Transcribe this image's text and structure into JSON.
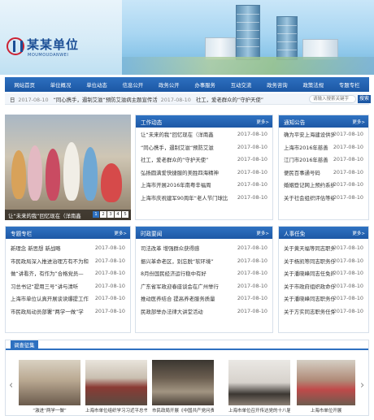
{
  "header": {
    "logo_title": "某某单位",
    "logo_subtitle": "MOUMOUDANWEI"
  },
  "nav": {
    "items": [
      "网站首页",
      "单位概况",
      "单位动态",
      "信息公开",
      "政务公开",
      "办事服务",
      "互动交流",
      "政务咨询",
      "政策法规",
      "专题专栏"
    ]
  },
  "ticker": {
    "items": [
      {
        "text": "日",
        "date": "2017-08-10"
      },
      {
        "text": "“同心携手，遏制艾滋“预防艾滋病主题宣传活",
        "date": "2017-08-10"
      },
      {
        "text": "社工，爱老群众的“守护天使”",
        "date": ""
      }
    ],
    "search_placeholder": "请输入搜索关键字",
    "search_button": "搜索"
  },
  "photo": {
    "caption": "让“未来的我”回忆现在（洋南鑫",
    "pages": [
      "1",
      "2",
      "3",
      "4",
      "5"
    ],
    "active_page": "1"
  },
  "work_news": {
    "title": "工作动态",
    "more": "更多>",
    "rows": [
      {
        "text": "让“未来的我”回忆现在（洋南鑫",
        "date": "2017-08-10"
      },
      {
        "text": "“同心携手，遏制艾滋“预防艾滋",
        "date": "2017-08-10"
      },
      {
        "text": "社工，爱老群众的“守护天使”",
        "date": "2017-08-10"
      },
      {
        "text": "弘扬圆满爱快捷服的美胜四海精神",
        "date": "2017-08-10"
      },
      {
        "text": "上海市开展2016年南粤辛福周",
        "date": "2017-08-10"
      },
      {
        "text": "上海市庆祝建军90周年“老人节门球比",
        "date": "2017-08-10"
      }
    ]
  },
  "notices": {
    "title": "通知公告",
    "more": "更多>",
    "rows": [
      {
        "text": "确为平安上海建设供贤",
        "date": "2017-08-10"
      },
      {
        "text": "上海市2016年慈善",
        "date": "2017-08-10"
      },
      {
        "text": "江门市2016年慈善",
        "date": "2017-08-10"
      },
      {
        "text": "便民百事通号码",
        "date": "2017-08-10"
      },
      {
        "text": "婚姻登记网上预约系统",
        "date": "2017-08-10"
      },
      {
        "text": "关于社会组织评估等级",
        "date": "2017-08-10"
      }
    ]
  },
  "topics": {
    "title": "专题专栏",
    "more": "更多>",
    "rows": [
      {
        "text": "新理念 新思想 新战略",
        "date": "2017-08-10"
      },
      {
        "text": "市民政局深入推进治理方有不为和",
        "date": "2017-08-10"
      },
      {
        "text": "做“讲看齐，有作为”合格党员—",
        "date": "2017-08-10"
      },
      {
        "text": "习总书记“提用三号”讲与清听",
        "date": "2017-08-10"
      },
      {
        "text": "上海市单位认真开展谈读爆提工作",
        "date": "2017-08-10"
      },
      {
        "text": "市民政局动员部署“两学一做”学",
        "date": "2017-08-10"
      }
    ]
  },
  "hot_topics": {
    "title": "时政要闻",
    "more": "更多>",
    "rows": [
      {
        "text": "司法改革 增强群众获得感",
        "date": "2017-08-10"
      },
      {
        "text": "振兴革命老区，别忘脱“软环境”",
        "date": "2017-08-10"
      },
      {
        "text": "8月份国民经济运行稳中有好",
        "date": "2017-08-10"
      },
      {
        "text": "广东省军政迎春座谈会在广州举行",
        "date": "2017-08-10"
      },
      {
        "text": "推动医养结合 提高养老服务质量",
        "date": "2017-08-10"
      },
      {
        "text": "民政部举办法律大讲堂活动",
        "date": "2017-08-10"
      }
    ]
  },
  "personnel": {
    "title": "人事任免",
    "more": "更多>",
    "rows": [
      {
        "text": "关于黄天福等同志职务",
        "date": "2017-08-10"
      },
      {
        "text": "关于杨凯等同志职务任",
        "date": "2017-08-10"
      },
      {
        "text": "关于潘晓峰同志任免的",
        "date": "2017-08-10"
      },
      {
        "text": "关于市政府组织政命任",
        "date": "2017-08-10"
      },
      {
        "text": "关于潘晓峰同志职务任",
        "date": "2017-08-10"
      },
      {
        "text": "关于方实同志职务任免",
        "date": "2017-08-10"
      }
    ]
  },
  "gallery": {
    "tab": "调查征集",
    "items": [
      {
        "label": "“激进“两学一做”"
      },
      {
        "label": "上海市单位组织学习习近平总书记"
      },
      {
        "label": "市民政局开展《中国共产党问责条"
      },
      {
        "label": "上海市单位召开传达党的十八届六中全"
      },
      {
        "label": "上海市单位开展"
      }
    ]
  }
}
